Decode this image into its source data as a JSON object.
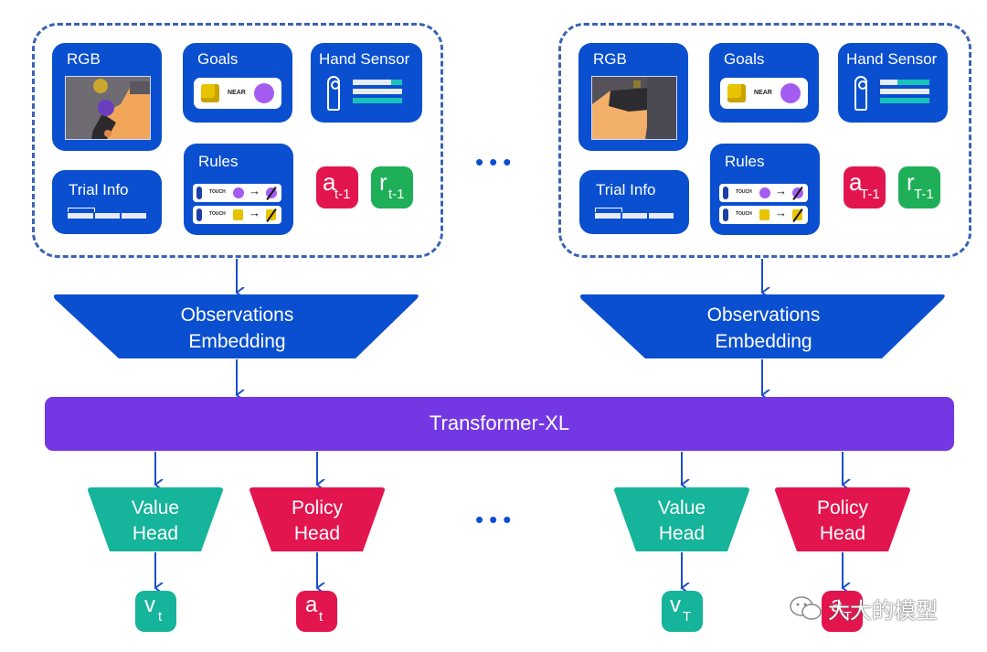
{
  "colors": {
    "card_blue": "#0a4fcf",
    "transformer_purple": "#7338e4",
    "value_teal": "#16b49a",
    "policy_red": "#e2154f",
    "reward_green": "#1eaf58",
    "arrow_blue": "#1a4fc9",
    "dashed_border": "#3b63b5"
  },
  "timesteps": [
    {
      "rgb_label": "RGB",
      "goals_label": "Goals",
      "goals_relation": "NEAR",
      "hand_sensor_label": "Hand Sensor",
      "trial_info_label": "Trial Info",
      "rules_label": "Rules",
      "rules": [
        {
          "action": "TOUCH",
          "object": "purple-sphere",
          "result": "purple-sphere-removed"
        },
        {
          "action": "TOUCH",
          "object": "yellow-cube",
          "result": "yellow-cube-removed"
        }
      ],
      "prev_action": {
        "main": "a",
        "sub": "t-1"
      },
      "prev_reward": {
        "main": "r",
        "sub": "t-1"
      },
      "embedding_label_line1": "Observations",
      "embedding_label_line2": "Embedding",
      "value_head_line1": "Value",
      "value_head_line2": "Head",
      "policy_head_line1": "Policy",
      "policy_head_line2": "Head",
      "value_out": {
        "main": "v",
        "sub": "t"
      },
      "policy_out": {
        "main": "a",
        "sub": "t"
      }
    },
    {
      "rgb_label": "RGB",
      "goals_label": "Goals",
      "goals_relation": "NEAR",
      "hand_sensor_label": "Hand Sensor",
      "trial_info_label": "Trial Info",
      "rules_label": "Rules",
      "rules": [
        {
          "action": "TOUCH",
          "object": "purple-sphere",
          "result": "purple-sphere-removed"
        },
        {
          "action": "TOUCH",
          "object": "yellow-cube",
          "result": "yellow-cube-removed"
        }
      ],
      "prev_action": {
        "main": "a",
        "sub": "T-1"
      },
      "prev_reward": {
        "main": "r",
        "sub": "T-1"
      },
      "embedding_label_line1": "Observations",
      "embedding_label_line2": "Embedding",
      "value_head_line1": "Value",
      "value_head_line2": "Head",
      "policy_head_line1": "Policy",
      "policy_head_line2": "Head",
      "value_out": {
        "main": "v",
        "sub": "T"
      },
      "policy_out": {
        "main": "a",
        "sub": "T"
      }
    }
  ],
  "ellipsis": "•••",
  "transformer_label": "Transformer-XL",
  "watermark": "大大的模型"
}
